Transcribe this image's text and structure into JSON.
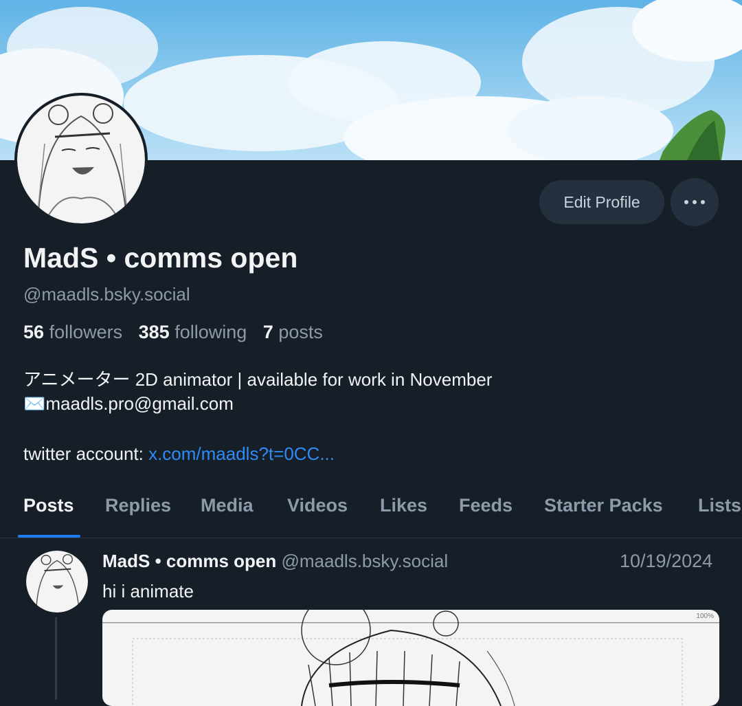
{
  "profile": {
    "display_name": "MadS • comms open",
    "handle": "@maadls.bsky.social",
    "followers_count": "56",
    "followers_label": "followers",
    "following_count": "385",
    "following_label": "following",
    "posts_count": "7",
    "posts_label": "posts",
    "bio_line1": "アニメーター  2D animator | available for work in November",
    "bio_line2": "✉️maadls.pro@gmail.com",
    "bio_line3_prefix": "twitter account: ",
    "bio_link": "x.com/maadls?t=0CC..."
  },
  "actions": {
    "edit_label": "Edit Profile",
    "more_icon": "ellipsis-icon"
  },
  "tabs": [
    {
      "label": "Posts",
      "active": true
    },
    {
      "label": "Replies"
    },
    {
      "label": "Media"
    },
    {
      "label": "Videos"
    },
    {
      "label": "Likes"
    },
    {
      "label": "Feeds"
    },
    {
      "label": "Starter Packs"
    },
    {
      "label": "Lists"
    }
  ],
  "post": {
    "author_name": "MadS • comms open",
    "author_handle": "@maadls.bsky.social",
    "date": "10/19/2024",
    "text": "hi i animate",
    "image_zoom": "100%"
  },
  "colors": {
    "background": "#161e27",
    "accent": "#1f7cf0",
    "link": "#2f8bf5",
    "muted": "#8d9aa9",
    "button_bg": "#25303f"
  }
}
